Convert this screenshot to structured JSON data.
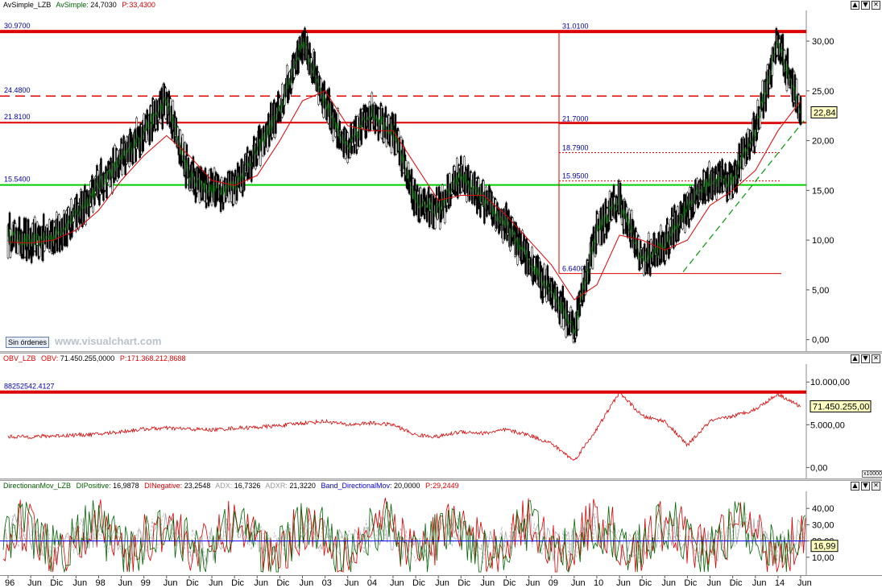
{
  "window": {
    "buttons": [
      "▲",
      "▼",
      "✕"
    ]
  },
  "price_panel": {
    "header": {
      "name": "AvSimple_LZB",
      "series": "AvSimple:",
      "series_value": "24,7030",
      "p_label": "P:",
      "p_value": "33,4300"
    },
    "sin_ordenes": "Sin órdenes",
    "watermark": "www.visualchart.com",
    "last_value": "22,84",
    "levels": [
      {
        "label": "30.9700",
        "value": 30.97,
        "color": "#dd0000",
        "style": "thick"
      },
      {
        "label": "24.4800",
        "value": 24.48,
        "color": "#dd0000",
        "style": "dashed"
      },
      {
        "label": "21.8100",
        "value": 21.81,
        "color": "#dd0000",
        "style": "solid"
      },
      {
        "label": "15.5400",
        "value": 15.54,
        "color": "#00cc00",
        "style": "solid"
      }
    ],
    "fib_labels": [
      {
        "label": "31.0100",
        "value": 31.01
      },
      {
        "label": "21.7000",
        "value": 21.7
      },
      {
        "label": "18.7900",
        "value": 18.79
      },
      {
        "label": "15.9500",
        "value": 15.95
      },
      {
        "label": "6.6400",
        "value": 6.64
      }
    ],
    "y_ticks": [
      "30,00",
      "25,00",
      "20,00",
      "15,00",
      "10,00",
      "5,00",
      "0,00"
    ]
  },
  "obv_panel": {
    "header": {
      "name": "OBV_LZB",
      "series": "OBV:",
      "series_value": "71.450.255,0000",
      "p_label": "P:",
      "p_value": "171.368.212,8688"
    },
    "level_label": "88252542.4127",
    "last_value": "71.450.255,00",
    "y_ticks": [
      "10.000,00",
      "5.000,00",
      "0,00"
    ],
    "scale_note": "x10000"
  },
  "dmi_panel": {
    "header": {
      "name": "DirectionanMov_LZB",
      "dip_label": "DIPositive:",
      "dip_value": "16,9878",
      "din_label": "DINegative:",
      "din_value": "23,2548",
      "adx_label": "ADX:",
      "adx_value": "16,7326",
      "adxr_label": "ADXR:",
      "adxr_value": "21,3220",
      "band_label": "Band_DirectionalMov:",
      "band_value": "20,0000",
      "p_label": "P:",
      "p_value": "29,2449"
    },
    "last_value": "16,99",
    "y_ticks": [
      "40,00",
      "30,00",
      "20,00",
      "10,00"
    ]
  },
  "x_axis": [
    "96",
    "Jun",
    "Dic",
    "Jun",
    "98",
    "Jun",
    "99",
    "Jun",
    "Dic",
    "Jun",
    "Dic",
    "Jun",
    "Dic",
    "Jun",
    "03",
    "Jun",
    "04",
    "Jun",
    "Dic",
    "Jun",
    "Dic",
    "Jun",
    "Dic",
    "Jun",
    "09",
    "Jun",
    "10",
    "Jun",
    "Dic",
    "Jun",
    "Dic",
    "Jun",
    "Dic",
    "Jun",
    "14",
    "Jun"
  ],
  "chart_data": {
    "type": "line",
    "title": "",
    "xlabel": "",
    "ylabel": "",
    "ylim": [
      -1,
      33
    ],
    "x": [
      "96",
      "Jun",
      "Dic",
      "Jun",
      "98",
      "Jun",
      "99",
      "Jun",
      "Dic",
      "Jun",
      "Dic",
      "Jun",
      "Dic",
      "Jun",
      "03",
      "Jun",
      "04",
      "Jun",
      "Dic",
      "Jun",
      "Dic",
      "Jun",
      "Dic",
      "Jun",
      "09",
      "Jun",
      "10",
      "Jun",
      "Dic",
      "Jun",
      "Dic",
      "Jun",
      "Dic",
      "Jun",
      "14",
      "Jun"
    ],
    "series": [
      {
        "name": "",
        "color": "#000000",
        "values": [
          10.5,
          9.8,
          10.4,
          12.5,
          15.5,
          18.0,
          21.0,
          24.0,
          16.5,
          15.0,
          15.5,
          19.0,
          23.0,
          30.0,
          24.0,
          19.0,
          23.0,
          21.0,
          14.0,
          13.0,
          16.5,
          14.0,
          11.5,
          8.0,
          5.0,
          1.0,
          11.0,
          14.0,
          8.0,
          9.5,
          13.5,
          16.0,
          16.0,
          21.0,
          30.0,
          23.0
        ]
      },
      {
        "name": "",
        "color": "#dd0000",
        "values": [
          9.8,
          9.7,
          10.0,
          11.0,
          13.0,
          16.0,
          18.5,
          20.5,
          18.5,
          16.0,
          15.5,
          16.5,
          20.0,
          24.0,
          25.0,
          21.5,
          21.0,
          21.0,
          17.5,
          14.0,
          14.5,
          14.5,
          12.5,
          10.0,
          7.5,
          4.0,
          5.5,
          10.5,
          10.0,
          9.0,
          10.0,
          13.5,
          15.0,
          17.0,
          21.0,
          24.0
        ]
      }
    ],
    "obv": [
      3.6,
      3.6,
      3.7,
      3.8,
      3.9,
      4.2,
      4.5,
      4.6,
      4.5,
      4.4,
      4.6,
      4.7,
      4.9,
      5.2,
      5.4,
      5.0,
      5.2,
      5.0,
      3.8,
      3.6,
      4.2,
      4.0,
      4.4,
      3.8,
      2.8,
      0.8,
      4.5,
      8.8,
      6.0,
      5.4,
      2.6,
      5.4,
      6.0,
      6.8,
      8.6,
      7.1
    ],
    "dmi_band": 20,
    "dmi_ylim": [
      0,
      50
    ]
  }
}
